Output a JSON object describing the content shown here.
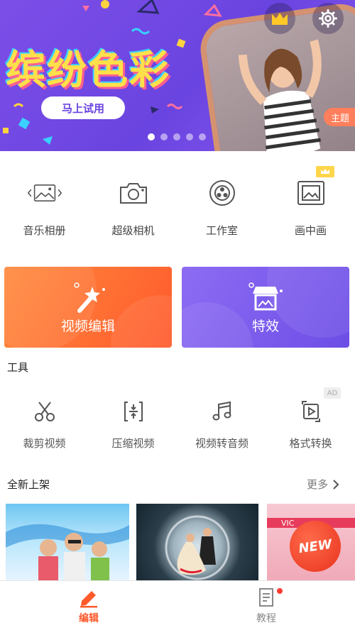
{
  "banner": {
    "title": "缤纷色彩",
    "try_button": "马上试用",
    "theme_tag": "主题",
    "slides": 5,
    "active_slide": 1
  },
  "features": [
    {
      "label": "音乐相册",
      "icon": "photo-slides-icon"
    },
    {
      "label": "超级相机",
      "icon": "camera-icon"
    },
    {
      "label": "工作室",
      "icon": "film-reel-icon"
    },
    {
      "label": "画中画",
      "icon": "picture-in-picture-icon"
    }
  ],
  "cards": {
    "edit_label": "视频编辑",
    "fx_label": "特效"
  },
  "tools": {
    "title": "工具",
    "ad_tag": "AD",
    "items": [
      {
        "label": "裁剪视频",
        "icon": "scissors-icon"
      },
      {
        "label": "压缩视频",
        "icon": "compress-icon"
      },
      {
        "label": "视频转音频",
        "icon": "music-note-icon"
      },
      {
        "label": "格式转换",
        "icon": "format-convert-icon"
      }
    ]
  },
  "new_arrivals": {
    "title": "全新上架",
    "more": "更多",
    "badge": "NEW",
    "thumb3_text": "VIC"
  },
  "nav": {
    "edit": "编辑",
    "tutorial": "教程"
  },
  "colors": {
    "accent": "#ff5a2c",
    "banner_purple": "#7d4ee8",
    "card_orange": "#ff6a35",
    "card_purple": "#7b5bee"
  }
}
